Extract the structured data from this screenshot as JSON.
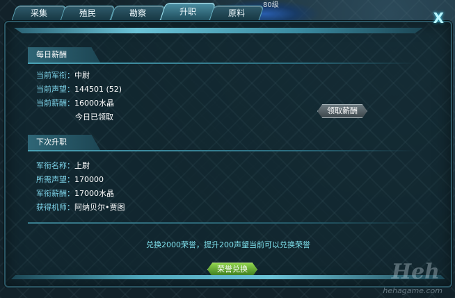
{
  "tabs": [
    {
      "label": "采集",
      "active": false
    },
    {
      "label": "殖民",
      "active": false
    },
    {
      "label": "勘察",
      "active": false
    },
    {
      "label": "升职",
      "active": true
    },
    {
      "label": "原料",
      "active": false
    }
  ],
  "world_label": "80级",
  "close_label": "X",
  "daily": {
    "title": "每日薪酬",
    "rank_label": "当前军衔：",
    "rank_value": "中尉",
    "fame_label": "当前声望：",
    "fame_value": "144501 (52)",
    "salary_label": "当前薪酬：",
    "salary_value": "16000水晶",
    "status": "今日已领取",
    "claim_button": "领取薪酬"
  },
  "next": {
    "title": "下次升职",
    "rank_label": "军衔名称：",
    "rank_value": "上尉",
    "fame_label": "所需声望：",
    "fame_value": "170000",
    "salary_label": "军衔薪酬：",
    "salary_value": "17000水晶",
    "mech_label": "获得机师：",
    "mech_value": "阿纳贝尔•贾图"
  },
  "notice": "兑换2000荣誉，提升200声望当前可以兑换荣誉",
  "honor_button": "荣誉兑换",
  "watermark": "hehagame.com",
  "logo_text": "Heh"
}
